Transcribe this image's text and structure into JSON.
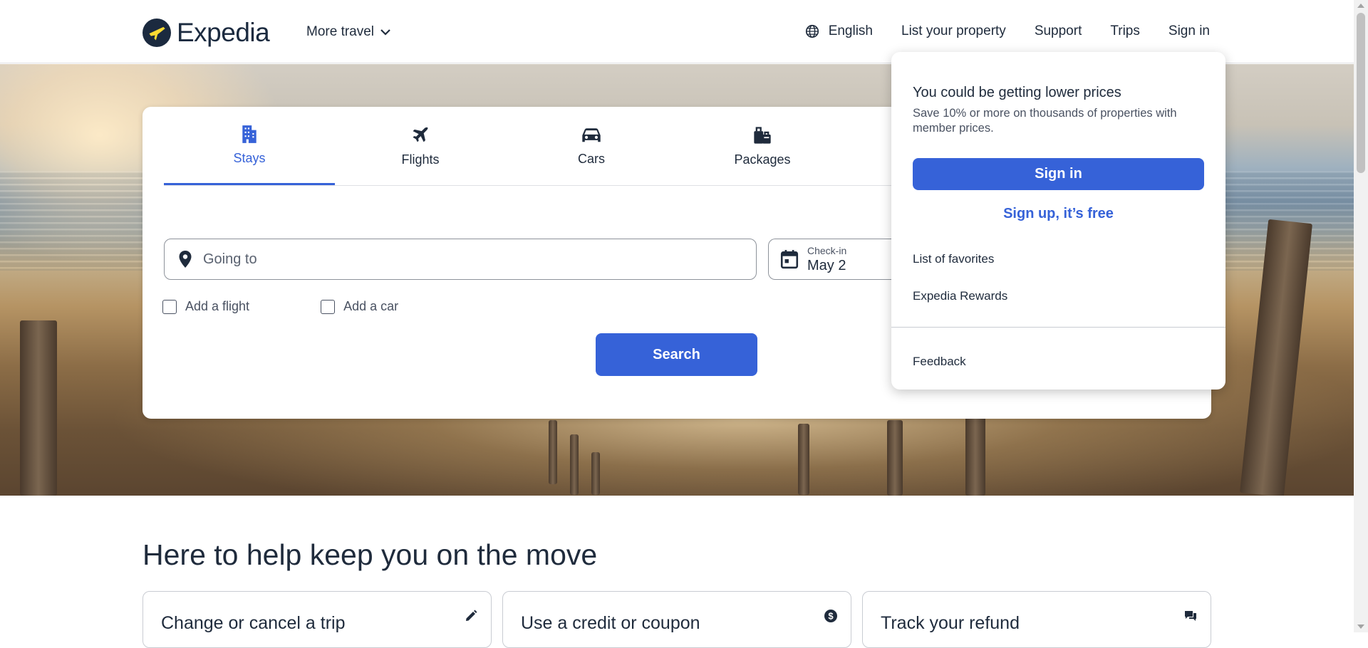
{
  "header": {
    "logo_text": "Expedia",
    "more_travel": "More travel",
    "language": "English",
    "list_property": "List your property",
    "support": "Support",
    "trips": "Trips",
    "sign_in": "Sign in"
  },
  "search": {
    "tabs": [
      {
        "label": "Stays",
        "icon": "building-icon",
        "active": true
      },
      {
        "label": "Flights",
        "icon": "airplane-icon",
        "active": false
      },
      {
        "label": "Cars",
        "icon": "car-icon",
        "active": false
      },
      {
        "label": "Packages",
        "icon": "luggage-icon",
        "active": false
      }
    ],
    "going_to_placeholder": "Going to",
    "checkin_label": "Check-in",
    "checkin_value": "May 2",
    "add_flight": "Add a flight",
    "add_car": "Add a car",
    "search_button": "Search"
  },
  "dropdown": {
    "title": "You could be getting lower prices",
    "subtitle": "Save 10% or more on thousands of properties with member prices.",
    "sign_in_button": "Sign in",
    "sign_up_link": "Sign up, it’s free",
    "favorites": "List of favorites",
    "rewards": "Expedia Rewards",
    "feedback": "Feedback"
  },
  "help": {
    "title": "Here to help keep you on the move",
    "cards": [
      {
        "label": "Change or cancel a trip",
        "icon": "pencil-icon"
      },
      {
        "label": "Use a credit or coupon",
        "icon": "dollar-coin-icon"
      },
      {
        "label": "Track your refund",
        "icon": "chat-icon"
      }
    ]
  },
  "colors": {
    "brand_blue": "#3662d8",
    "navy": "#1b2a3f",
    "text": "#1f2b3c"
  }
}
